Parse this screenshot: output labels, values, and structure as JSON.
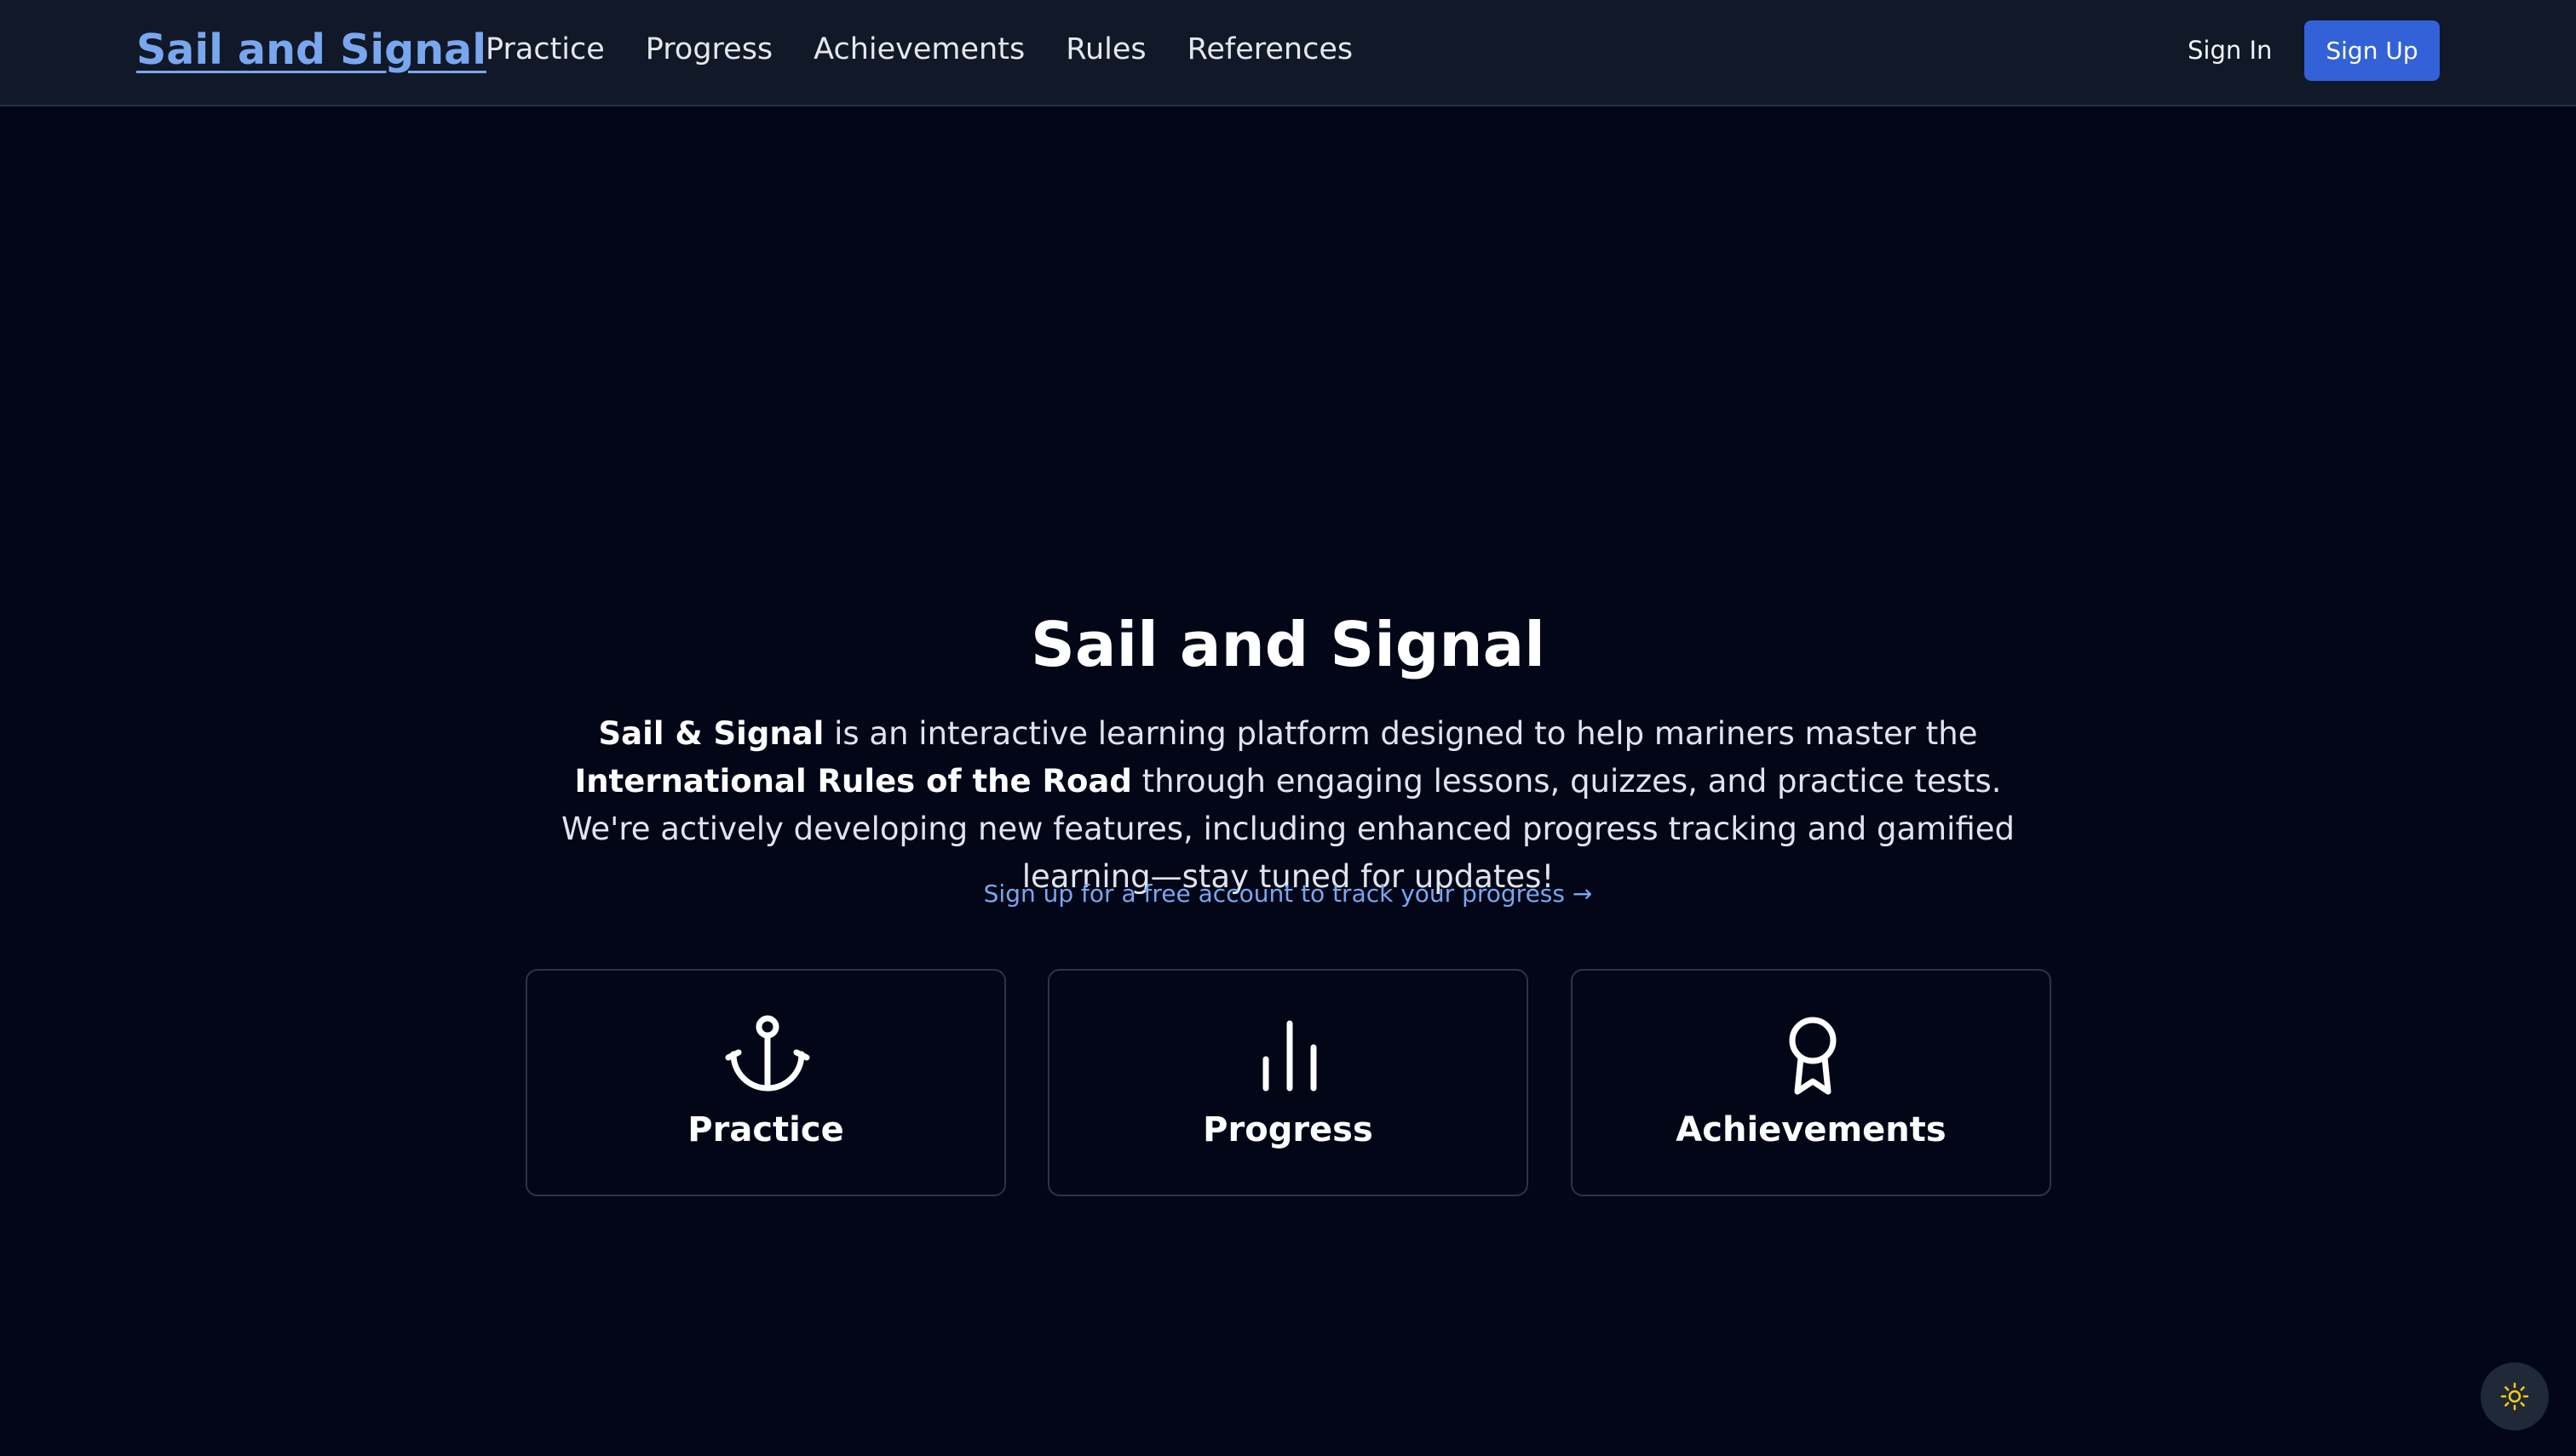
{
  "header": {
    "brand": "Sail and Signal",
    "nav": [
      "Practice",
      "Progress",
      "Achievements",
      "Rules",
      "References"
    ],
    "sign_in": "Sign In",
    "sign_up": "Sign Up",
    "accent_color": "#79a7ef",
    "button_color": "#3361d8"
  },
  "hero": {
    "title": "Sail and Signal",
    "intro": {
      "brand_bold": "Sail & Signal",
      "text_1": " is an interactive learning platform designed to help mariners master the ",
      "rules_bold": "International Rules of the Road",
      "text_2": " through engaging lessons, quizzes, and practice tests. We're actively developing new features, including enhanced progress tracking and gamified learning—stay tuned for updates!"
    },
    "cta": "Sign up for a free account to track your progress →"
  },
  "cards": [
    {
      "label": "Practice",
      "icon": "anchor-icon"
    },
    {
      "label": "Progress",
      "icon": "bar-chart-icon"
    },
    {
      "label": "Achievements",
      "icon": "award-ribbon-icon"
    }
  ],
  "theme_toggle": {
    "icon": "sun-icon"
  }
}
